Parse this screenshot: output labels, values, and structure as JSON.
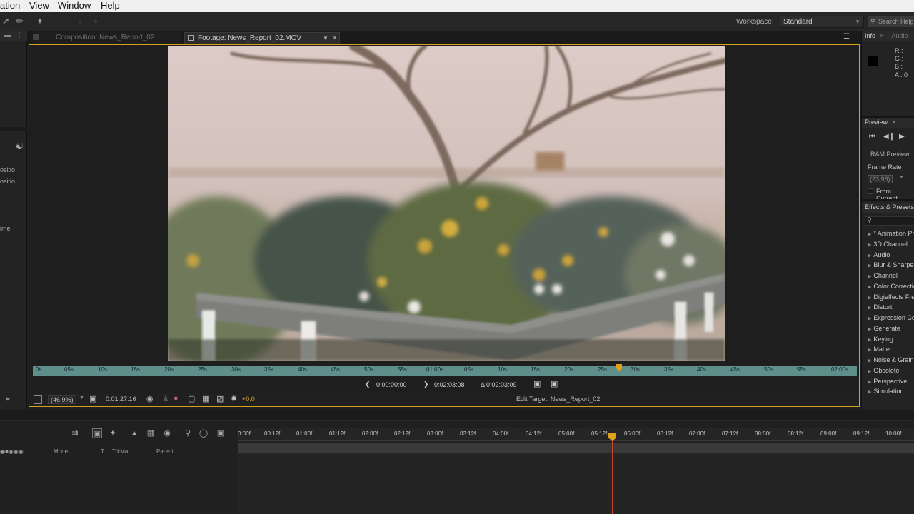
{
  "menu": {
    "items": [
      "ation",
      "View",
      "Window",
      "Help"
    ]
  },
  "toolbar": {
    "workspace_label": "Workspace:",
    "workspace_value": "Standard",
    "search_placeholder": "Search Help"
  },
  "viewer": {
    "tabs": [
      {
        "label": "Composition: News_Report_02"
      },
      {
        "label": "Footage: News_Report_02.MOV"
      }
    ],
    "ruler_ticks": [
      "0s",
      "05s",
      "10s",
      "15s",
      "20s",
      "25s",
      "30s",
      "35s",
      "40s",
      "45s",
      "50s",
      "55s",
      "01:00s",
      "05s",
      "10s",
      "15s",
      "20s",
      "25s",
      "30s",
      "35s",
      "40s",
      "45s",
      "50s",
      "55s",
      "02:00s"
    ],
    "in_point": "0:00:00:00",
    "out_point": "0:02:03:08",
    "duration": "Δ 0:02:03:09",
    "zoom": "(46.9%)",
    "current_time": "0:01:27:16",
    "exposure": "+0.0",
    "edit_target": "Edit Target: News_Report_02"
  },
  "left_panel": {
    "labels": [
      "ositio",
      "ositio",
      "ime"
    ]
  },
  "right_panel": {
    "info": {
      "title": "Info",
      "tab2": "Audio",
      "r": "R :",
      "g": "G :",
      "b": "B :",
      "a": "A : 0"
    },
    "preview": {
      "title": "Preview",
      "ram_preview": "RAM Preview",
      "frame_rate_label": "Frame Rate",
      "frame_rate_value": "(23.98)",
      "from_current": "From Current"
    },
    "effects": {
      "title": "Effects & Presets",
      "items": [
        "* Animation Presets",
        "3D Channel",
        "Audio",
        "Blur & Sharpen",
        "Channel",
        "Color Correction",
        "Digieffects FreeForm",
        "Distort",
        "Expression Controls",
        "Generate",
        "Keying",
        "Matte",
        "Noise & Grain",
        "Obsolete",
        "Perspective",
        "Simulation"
      ]
    }
  },
  "timeline": {
    "ruler_ticks": [
      "0:00f",
      "00:12f",
      "01:00f",
      "01:12f",
      "02:00f",
      "02:12f",
      "03:00f",
      "03:12f",
      "04:00f",
      "04:12f",
      "05:00f",
      "05:12f",
      "06:00f",
      "06:12f",
      "07:00f",
      "07:12f",
      "08:00f",
      "08:12f",
      "09:00f",
      "09:12f",
      "10:00f"
    ],
    "headers": {
      "mode": "Mode",
      "t": "T",
      "trkmat": "TrkMat",
      "parent": "Parent"
    }
  },
  "colors": {
    "accent": "#d6a21b",
    "cti": "#e0a21c",
    "ruler": "#5f8f8a"
  }
}
